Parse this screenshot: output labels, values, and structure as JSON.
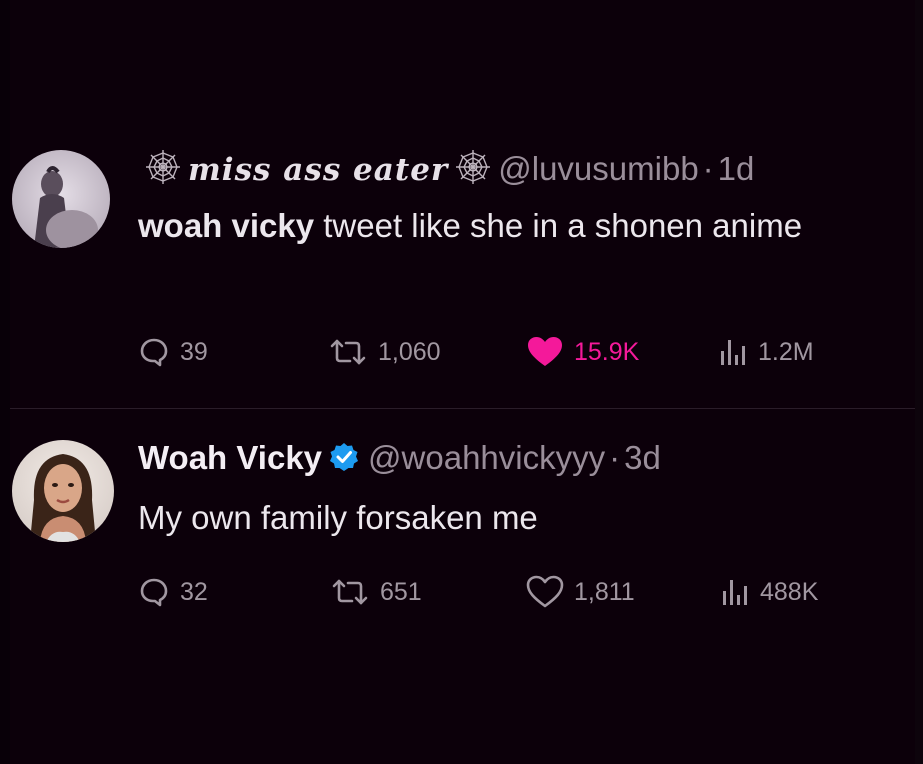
{
  "colors": {
    "background": "#0c000a",
    "text": "#ece7ed",
    "muted": "#9a8e9a",
    "like_active": "#f4199a",
    "verified": "#1d9bf0"
  },
  "tweets": [
    {
      "display_name": "miss ass eater",
      "name_decoration_icon": "spider-web-icon",
      "handle": "@luvusumibb",
      "separator": "·",
      "time": "1d",
      "text_bold": "woah vicky",
      "text_rest": " tweet like she in a shonen anime",
      "stats": {
        "replies": "39",
        "retweets": "1,060",
        "likes": "15.9K",
        "views": "1.2M"
      },
      "liked": true
    },
    {
      "display_name": "Woah Vicky",
      "badge_icon": "verified-badge-icon",
      "handle": "@woahhvickyyy",
      "separator": "·",
      "time": "3d",
      "text_bold": "",
      "text_rest": "My own family forsaken me",
      "stats": {
        "replies": "32",
        "retweets": "651",
        "likes": "1,811",
        "views": "488K"
      },
      "liked": false
    }
  ]
}
